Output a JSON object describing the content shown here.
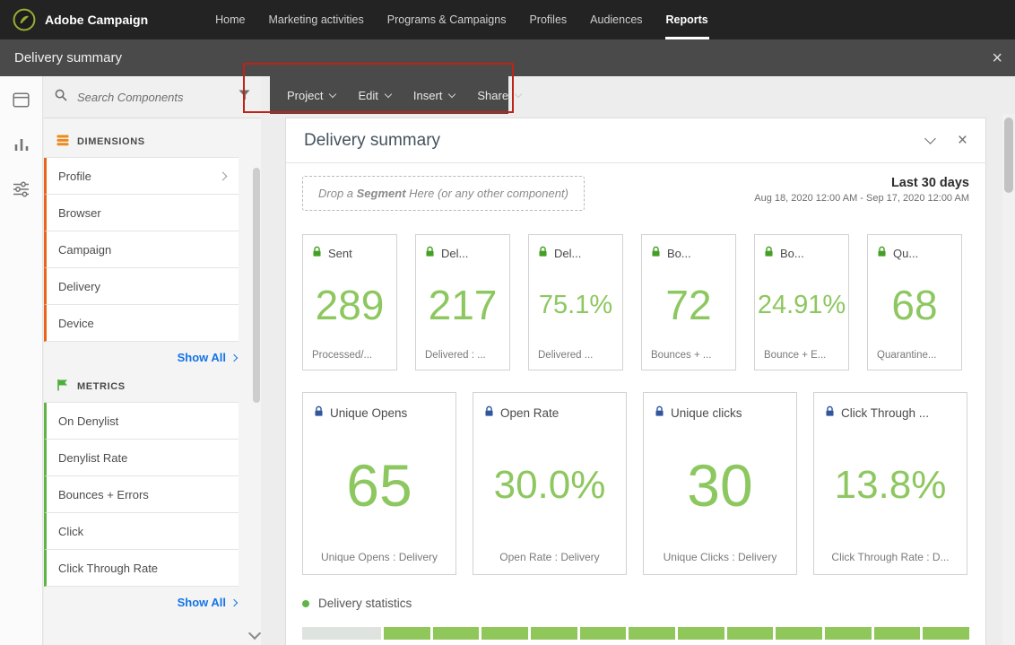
{
  "topnav": {
    "brand": "Adobe Campaign",
    "items": [
      {
        "label": "Home"
      },
      {
        "label": "Marketing activities"
      },
      {
        "label": "Programs & Campaigns"
      },
      {
        "label": "Profiles"
      },
      {
        "label": "Audiences"
      },
      {
        "label": "Reports"
      }
    ],
    "active": "Reports"
  },
  "titlebar": {
    "title": "Delivery summary",
    "close_glyph": "×"
  },
  "menubar": {
    "items": [
      {
        "label": "Project"
      },
      {
        "label": "Edit"
      },
      {
        "label": "Insert"
      },
      {
        "label": "Share"
      }
    ]
  },
  "rail": {
    "icons": [
      {
        "name": "layout-icon"
      },
      {
        "name": "chart-icon"
      },
      {
        "name": "sliders-icon"
      }
    ]
  },
  "sidebar": {
    "search_placeholder": "Search Components",
    "dimensions": {
      "title": "DIMENSIONS",
      "items": [
        {
          "label": "Profile",
          "expandable": true
        },
        {
          "label": "Browser"
        },
        {
          "label": "Campaign"
        },
        {
          "label": "Delivery"
        },
        {
          "label": "Device"
        }
      ],
      "show_all": "Show All"
    },
    "metrics": {
      "title": "METRICS",
      "items": [
        {
          "label": "On Denylist"
        },
        {
          "label": "Denylist Rate"
        },
        {
          "label": "Bounces + Errors"
        },
        {
          "label": "Click"
        },
        {
          "label": "Click Through Rate"
        }
      ],
      "show_all": "Show All"
    }
  },
  "report": {
    "title": "Delivery summary",
    "close_glyph": "×",
    "dropzone": {
      "prefix": "Drop a ",
      "bold": "Segment",
      "suffix": " Here (or any other component)"
    },
    "period": {
      "label": "Last 30 days",
      "range": "Aug 18, 2020 12:00 AM - Sep 17, 2020 12:00 AM"
    },
    "kpis_row1": [
      {
        "label": "Sent",
        "value": "289",
        "caption": "Processed/..."
      },
      {
        "label": "Del...",
        "value": "217",
        "caption": "Delivered : ..."
      },
      {
        "label": "Del...",
        "value": "75.1%",
        "caption": "Delivered ..."
      },
      {
        "label": "Bo...",
        "value": "72",
        "caption": "Bounces + ..."
      },
      {
        "label": "Bo...",
        "value": "24.91%",
        "caption": "Bounce + E..."
      },
      {
        "label": "Qu...",
        "value": "68",
        "caption": "Quarantine..."
      }
    ],
    "kpis_row2": [
      {
        "label": "Unique Opens",
        "value": "65",
        "caption": "Unique Opens : Delivery"
      },
      {
        "label": "Open Rate",
        "value": "30.0%",
        "caption": "Open Rate : Delivery"
      },
      {
        "label": "Unique clicks",
        "value": "30",
        "caption": "Unique Clicks : Delivery"
      },
      {
        "label": "Click Through ...",
        "value": "13.8%",
        "caption": "Click Through Rate : D..."
      }
    ],
    "statistics": {
      "title": "Delivery statistics"
    }
  },
  "colors": {
    "accent_green": "#8dc75f",
    "dimension_orange": "#e8651a",
    "metric_green": "#5fb446",
    "link_blue": "#1473e6",
    "annotation_red": "#bf2318",
    "lock_green": "#44a024",
    "lock_blue": "#30569d",
    "topnav_bg": "#232323",
    "titlebar_bg": "#4a4a4a"
  }
}
